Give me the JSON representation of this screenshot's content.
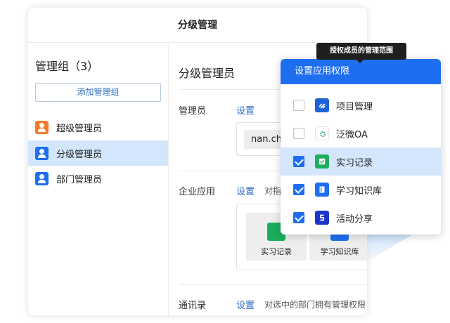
{
  "window": {
    "title": "分级管理"
  },
  "sidebar": {
    "title": "管理组（3）",
    "add_button": "添加管理组",
    "items": [
      {
        "label": "超级管理员",
        "color": "#f07c2e"
      },
      {
        "label": "分级管理员",
        "color": "#1e6ff0"
      },
      {
        "label": "部门管理员",
        "color": "#1e6ff0"
      }
    ]
  },
  "content": {
    "title": "分级管理员",
    "rows": {
      "admin": {
        "label": "管理员",
        "link": "设置",
        "chip": "nan.ch"
      },
      "apps": {
        "label": "企业应用",
        "link": "设置",
        "desc": "对指",
        "tiles": [
          {
            "label": "实习记录",
            "color": "#1aad5b"
          },
          {
            "label": "学习知识库",
            "color": "#1e6ff0"
          }
        ]
      },
      "contacts": {
        "label": "通讯录",
        "link": "设置",
        "desc": "对选中的部门拥有管理权限"
      }
    }
  },
  "tooltip": {
    "text": "授权成员的管理范围"
  },
  "popup": {
    "title": "设置应用权限",
    "accent": "#1e6ff0",
    "items": [
      {
        "label": "项目管理",
        "checked": false,
        "icon": "project-icon",
        "color": "#1e62d6"
      },
      {
        "label": "泛微OA",
        "checked": false,
        "icon": "weaver-icon",
        "color": "#1aa05b"
      },
      {
        "label": "实习记录",
        "checked": true,
        "icon": "internship-icon",
        "color": "#1aad5b"
      },
      {
        "label": "学习知识库",
        "checked": true,
        "icon": "knowledge-icon",
        "color": "#1e6ff0"
      },
      {
        "label": "活动分享",
        "checked": true,
        "icon": "activity-icon",
        "color": "#1b35c8"
      }
    ]
  }
}
